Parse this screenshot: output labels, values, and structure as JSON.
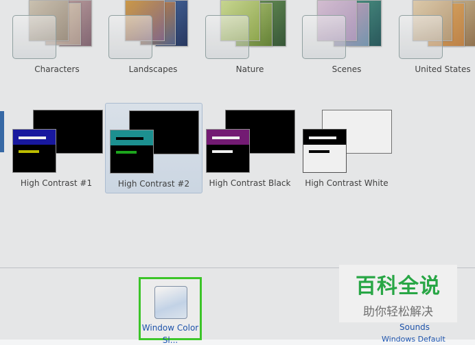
{
  "themes": [
    {
      "label": "Characters"
    },
    {
      "label": "Landscapes"
    },
    {
      "label": "Nature"
    },
    {
      "label": "Scenes"
    },
    {
      "label": "United States"
    }
  ],
  "high_contrast": [
    {
      "label": "High Contrast #1",
      "accent": "#1a1aa8",
      "bar1": "#ffffff",
      "bar2": "#c8c800"
    },
    {
      "label": "High Contrast #2",
      "accent": "#1e9a9a",
      "bar1": "#000000",
      "bar2": "#1fb01f",
      "selected": true
    },
    {
      "label": "High Contrast Black",
      "accent": "#7b1d7b",
      "bar1": "#ffffff",
      "bar2": "#ffffff"
    },
    {
      "label": "High Contrast White",
      "accent": "#ffffff",
      "bar1": "#000000",
      "bar2": "#000000"
    }
  ],
  "bottom": {
    "window_color_label": "Window Color",
    "window_color_label2": "Sl...",
    "sounds_label": "Sounds",
    "cut_label": "Windows Default"
  },
  "watermark": {
    "title": "百科全说",
    "subtitle": "助你轻松解决"
  },
  "colors": {
    "highlight_border": "#3fd12b",
    "link": "#1f58b5"
  }
}
